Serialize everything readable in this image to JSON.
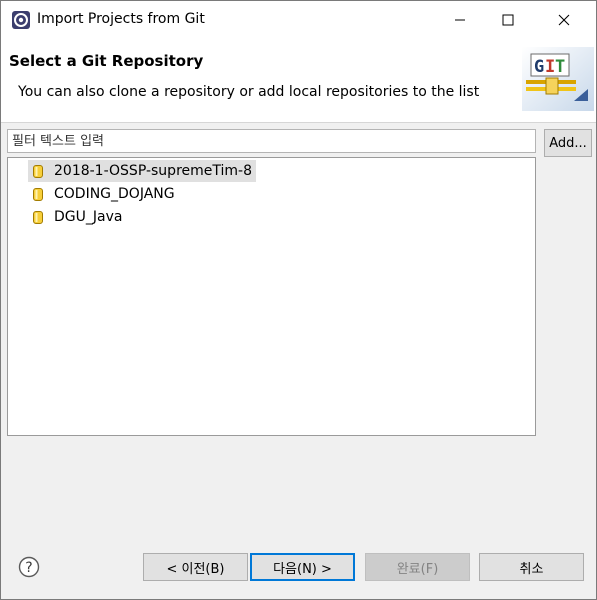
{
  "window": {
    "title": "Import Projects from Git",
    "icon": "eclipse-icon"
  },
  "banner": {
    "title": "Select a Git Repository",
    "description": "You can also clone a repository or add local repositories to the list",
    "logo_text": "GIT"
  },
  "filter": {
    "placeholder": "필터 텍스트 입력",
    "value": ""
  },
  "add_button": {
    "label": "Add..."
  },
  "repositories": [
    {
      "name": "2018-1-OSSP-supremeTim-8",
      "selected": true
    },
    {
      "name": "CODING_DOJANG",
      "selected": false
    },
    {
      "name": "DGU_Java",
      "selected": false
    }
  ],
  "buttons": {
    "back": "< 이전(B)",
    "next": "다음(N) >",
    "finish": "완료(F)",
    "cancel": "취소"
  },
  "colors": {
    "accent": "#0078d7",
    "selection": "#e0e0e0",
    "repo_icon": "#f3c21a"
  }
}
